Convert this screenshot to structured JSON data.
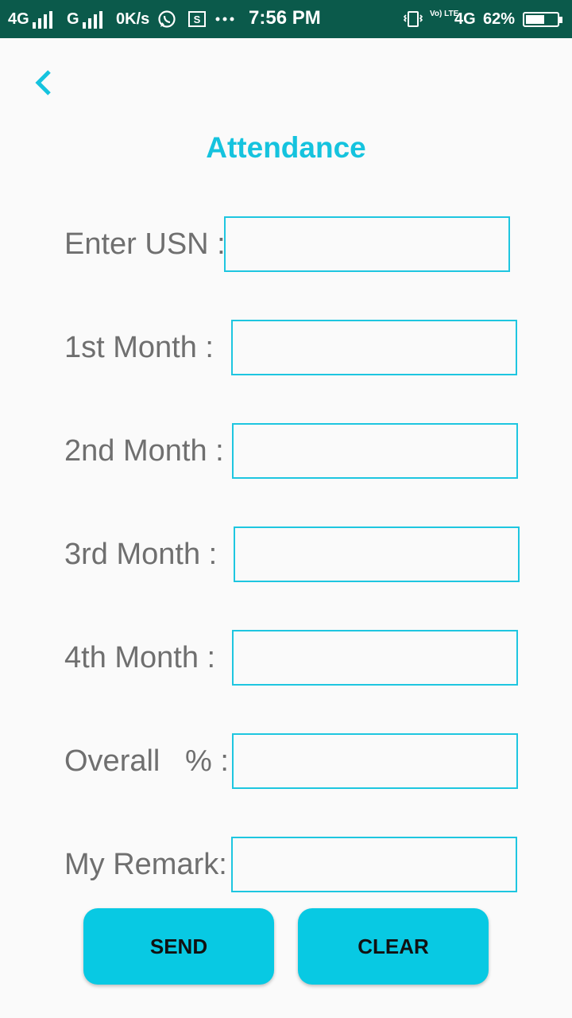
{
  "status_bar": {
    "network1": "4G",
    "network2": "G",
    "speed": "0K/s",
    "time": "7:56 PM",
    "volte": "Vo) LTE",
    "network3": "4G",
    "battery": "62%",
    "battery_level": 0.62,
    "icons": [
      "whatsapp-icon",
      "screenshot-icon",
      "more-dots-icon",
      "vibrate-icon",
      "battery-icon"
    ]
  },
  "header": {
    "back_icon": "chevron-left-icon",
    "title": "Attendance"
  },
  "form": {
    "fields": [
      {
        "label": "Enter USN :",
        "value": ""
      },
      {
        "label": "1st Month :",
        "value": ""
      },
      {
        "label": "2nd Month :",
        "value": ""
      },
      {
        "label": "3rd Month :",
        "value": ""
      },
      {
        "label": "4th Month :",
        "value": ""
      },
      {
        "label": "Overall   % :",
        "value": ""
      },
      {
        "label": "My Remark:",
        "value": ""
      }
    ]
  },
  "buttons": {
    "send": "SEND",
    "clear": "CLEAR"
  },
  "colors": {
    "accent": "#15c3de",
    "button": "#08c9e3",
    "status_bar": "#0b5a4b",
    "label": "#6f6f6f"
  }
}
